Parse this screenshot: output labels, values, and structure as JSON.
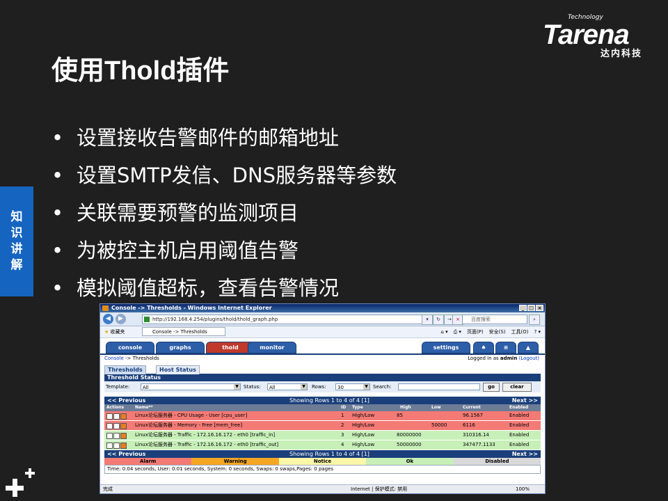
{
  "brand": {
    "name": "Tarena",
    "tagline": "Technology",
    "cn_name": "达内科技"
  },
  "slide": {
    "title": "使用Thold插件",
    "bullets": [
      "设置接收告警邮件的邮箱地址",
      "设置SMTP发信、DNS服务器等参数",
      "关联需要预警的监测项目",
      "为被控主机启用阈值告警",
      "模拟阈值超标，查看告警情况"
    ],
    "side_tab": [
      "知",
      "识",
      "讲",
      "解"
    ]
  },
  "browser": {
    "window_title": "Console -> Thresholds - Windows Internet Explorer",
    "address": "http://192.168.4.254/plugins/thold/thold_graph.php",
    "search_placeholder": "百度搜索",
    "favorites": "收藏夹",
    "tab_title": "Console -> Thresholds",
    "tools": [
      "页面(P)",
      "安全(S)",
      "工具(O)"
    ],
    "status_done": "完成",
    "status_zone": "Internet | 保护模式: 禁用",
    "zoom": "100%"
  },
  "cacti": {
    "tabs": [
      "console",
      "graphs",
      "thold",
      "monitor"
    ],
    "settings_tab": "settings",
    "breadcrumb_link": "Console",
    "breadcrumb_rest": " -> Thresholds",
    "logged_in_prefix": "Logged in as ",
    "user": "admin",
    "logout": "(Logout)",
    "subtabs": [
      "Thresholds",
      "Host Status"
    ],
    "panel_title": "Threshold Status",
    "filter": {
      "template_label": "Template:",
      "template_value": "All",
      "status_label": "Status:",
      "status_value": "All",
      "rows_label": "Rows:",
      "rows_value": "30",
      "search_label": "Search:",
      "go": "go",
      "clear": "clear"
    },
    "pager": {
      "prev": "<< Previous",
      "showing": "Showing Rows 1 to 4 of 4 [1]",
      "next": "Next >>"
    },
    "columns": [
      "Actions",
      "Name**",
      "ID",
      "Type",
      "High",
      "Low",
      "Current",
      "Enabled"
    ],
    "rows": [
      {
        "name": "Linux论坛服务器 - CPU Usage - User [cpu_user]",
        "id": "1",
        "type": "High/Low",
        "high": "85",
        "low": "",
        "current": "96.1567",
        "enabled": "Enabled",
        "state": "alarm"
      },
      {
        "name": "Linux论坛服务器 - Memory - Free [mem_free]",
        "id": "2",
        "type": "High/Low",
        "high": "",
        "low": "50000",
        "current": "6116",
        "enabled": "Enabled",
        "state": "alarm"
      },
      {
        "name": "Linux论坛服务器 - Traffic - 172.16.16.172 - eth0 [traffic_in]",
        "id": "3",
        "type": "High/Low",
        "high": "80000000",
        "low": "",
        "current": "310316.14",
        "enabled": "Enabled",
        "state": "ok"
      },
      {
        "name": "Linux论坛服务器 - Traffic - 172.16.16.172 - eth0 [traffic_out]",
        "id": "4",
        "type": "High/Low",
        "high": "50000000",
        "low": "",
        "current": "347477.1133",
        "enabled": "Enabled",
        "state": "ok"
      }
    ],
    "legend": [
      {
        "label": "Alarm",
        "color": "#f37a75"
      },
      {
        "label": "Warning",
        "color": "#f5a623"
      },
      {
        "label": "Notice",
        "color": "#fff7a8"
      },
      {
        "label": "Ok",
        "color": "#c7f0b8"
      },
      {
        "label": "Disabled",
        "color": "#d9d9d9"
      }
    ],
    "timing": "Time: 0.04 seconds, User: 0.01 seconds, System: 0 seconds, Swaps: 0 swaps,Pages: 0 pages"
  }
}
